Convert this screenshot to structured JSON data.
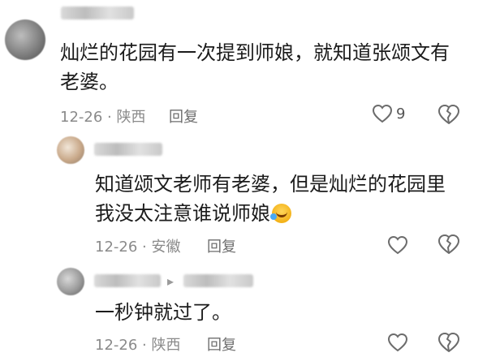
{
  "comments": [
    {
      "content_line1": "灿烂的花园有一次提到师娘，就知道张颂文有",
      "content_line2": "老婆。",
      "date_location": "12-26 · 陕西",
      "reply_label": "回复",
      "like_count": "9"
    },
    {
      "content_line1": "知道颂文老师有老婆，但是灿烂的花园里",
      "content_line2": "我没太注意谁说师娘",
      "date_location": "12-26 · 安徽",
      "reply_label": "回复"
    },
    {
      "content_line1": "一秒钟就过了。",
      "date_location": "12-26 · 陕西",
      "reply_label": "回复"
    }
  ],
  "icons": {
    "like": "heart-outline-icon",
    "dislike": "broken-heart-icon",
    "emoji": "laughing-emoji-icon",
    "reply_arrow": "reply-arrow-icon"
  },
  "colors": {
    "meta": "#8a8a8a",
    "text": "#1b1b1b"
  }
}
